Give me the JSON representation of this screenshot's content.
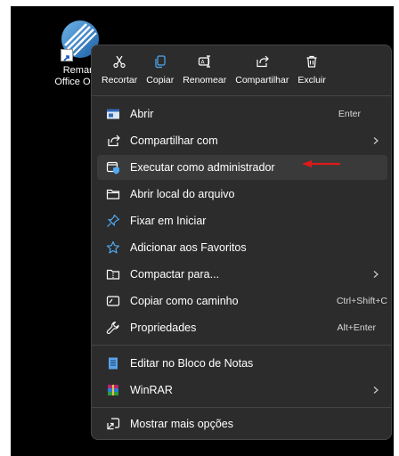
{
  "desktop": {
    "shortcut_name": [
      "Remark",
      "Office OMR"
    ],
    "icon": "remark-office-omr-app-icon"
  },
  "context_menu": {
    "top_actions": [
      {
        "label": "Recortar",
        "icon": "scissors-icon"
      },
      {
        "label": "Copiar",
        "icon": "copy-icon"
      },
      {
        "label": "Renomear",
        "icon": "rename-icon"
      },
      {
        "label": "Compartilhar",
        "icon": "share-icon"
      },
      {
        "label": "Excluir",
        "icon": "trash-icon"
      }
    ],
    "items": [
      {
        "label": "Abrir",
        "shortcut": "Enter",
        "icon": "open-window-icon"
      },
      {
        "label": "Compartilhar com",
        "submenu": true,
        "icon": "share-icon"
      },
      {
        "label": "Executar como administrador",
        "icon": "admin-shield-icon",
        "highlighted": true
      },
      {
        "label": "Abrir local do arquivo",
        "icon": "folder-icon"
      },
      {
        "label": "Fixar em Iniciar",
        "icon": "pin-icon"
      },
      {
        "label": "Adicionar aos Favoritos",
        "icon": "star-icon"
      },
      {
        "label": "Compactar para...",
        "submenu": true,
        "icon": "zip-folder-icon"
      },
      {
        "label": "Copiar como caminho",
        "shortcut": "Ctrl+Shift+C",
        "icon": "copy-path-icon"
      },
      {
        "label": "Propriedades",
        "shortcut": "Alt+Enter",
        "icon": "wrench-icon"
      },
      {
        "label": "Editar no Bloco de Notas",
        "icon": "notepad-icon"
      },
      {
        "label": "WinRAR",
        "submenu": true,
        "icon": "winrar-icon"
      },
      {
        "label": "Mostrar mais opções",
        "icon": "more-options-icon"
      }
    ]
  },
  "colors": {
    "menu_bg": "#2c2c2c",
    "highlight": "#3a3a3a",
    "accent_blue": "#4fa9f3",
    "annotation_arrow": "#e0191a"
  }
}
